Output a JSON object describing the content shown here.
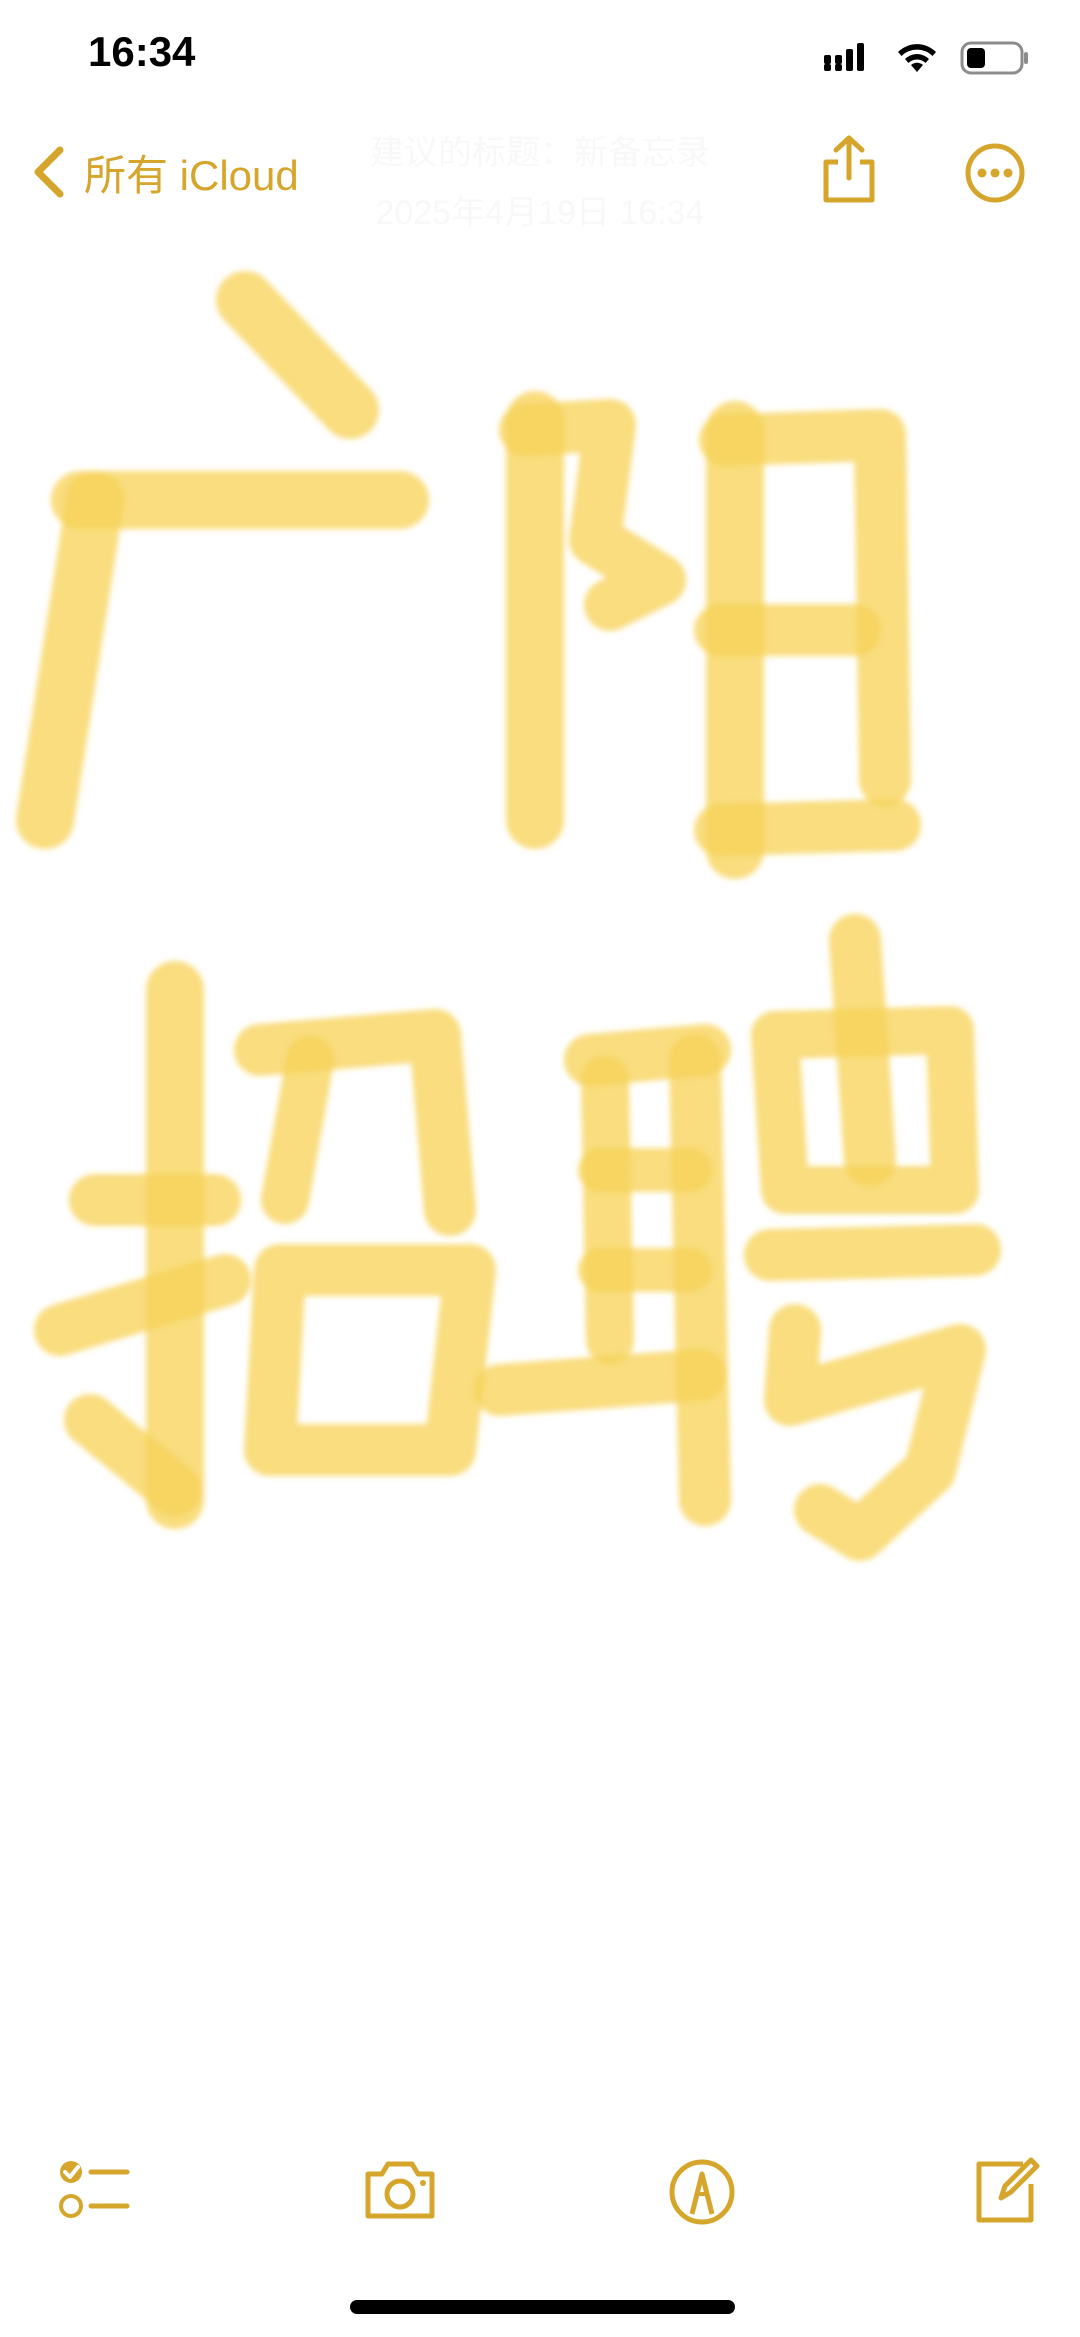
{
  "status_bar": {
    "time": "16:34"
  },
  "nav": {
    "back_label": "所有 iCloud",
    "header_hint": "建议的标题：新备忘录",
    "date_hint": "2025年4月19日 16:34"
  },
  "drawing": {
    "stroke_color": "#f7d35a",
    "lines": [
      "广阳",
      "招聘"
    ]
  },
  "toolbar": {
    "icons": [
      "checklist-icon",
      "camera-icon",
      "markup-pen-icon",
      "compose-icon"
    ]
  },
  "colors": {
    "accent": "#d5a62b",
    "ink": "#f7d35a"
  }
}
